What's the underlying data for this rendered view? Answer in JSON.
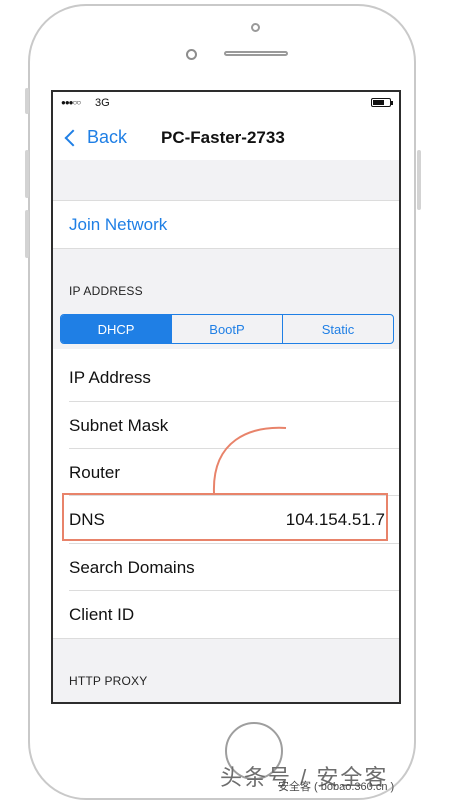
{
  "status_bar": {
    "signal": "●●●○○",
    "carrier": "3G",
    "battery_level": 0.6
  },
  "nav": {
    "back_label": "Back",
    "title": "PC-Faster-2733"
  },
  "join_network": "Join Network",
  "ip_section": {
    "header": "IP ADDRESS",
    "segments": [
      "DHCP",
      "BootP",
      "Static"
    ],
    "selected_segment": "DHCP"
  },
  "rows": [
    {
      "label": "IP Address",
      "value": ""
    },
    {
      "label": "Subnet Mask",
      "value": ""
    },
    {
      "label": "Router",
      "value": ""
    },
    {
      "label": "DNS",
      "value": "104.154.51.7"
    },
    {
      "label": "Search Domains",
      "value": ""
    },
    {
      "label": "Client ID",
      "value": ""
    }
  ],
  "http_proxy_header": "HTTP PROXY",
  "watermark": {
    "main": "头条号 / 安全客",
    "sub": "安全客 ( bobao.360.cn )"
  },
  "colors": {
    "accent": "#1f7fe5",
    "annotation": "#e8836a"
  }
}
